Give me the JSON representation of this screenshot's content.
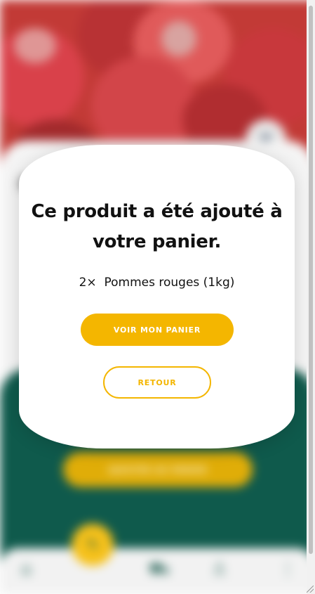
{
  "modal": {
    "title": "Ce produit a été ajouté à votre panier.",
    "item_quantity": "2×",
    "item_name": "Pommes rouges (1kg)",
    "primary_button": "VOIR MON PANIER",
    "secondary_button": "RETOUR"
  },
  "background": {
    "add_to_cart_label": "AJOUTER AU PANIER",
    "icons": {
      "favorite": "heart-icon",
      "home": "home-icon",
      "fab": "leaf-icon",
      "cart": "cart-icon",
      "account": "user-icon",
      "more": "more-icon"
    }
  },
  "colors": {
    "accent": "#f4b600",
    "green_panel": "#0f5a4c",
    "modal_bg": "#ffffff"
  }
}
